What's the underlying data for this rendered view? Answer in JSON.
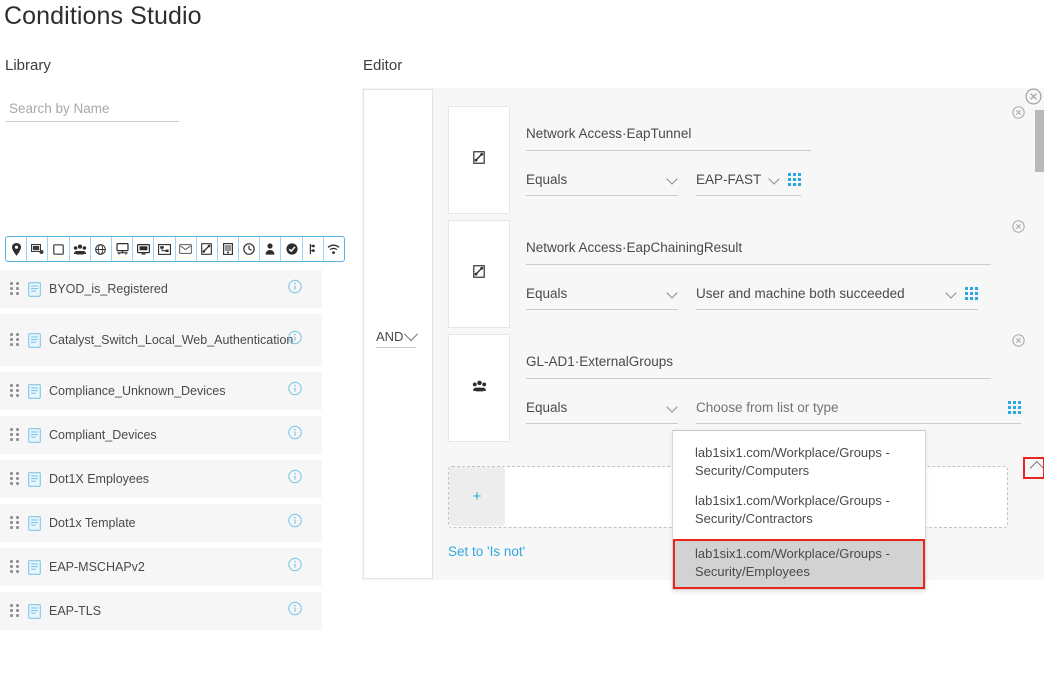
{
  "page": {
    "title": "Conditions Studio"
  },
  "library": {
    "label": "Library",
    "search": {
      "placeholder": "Search by Name",
      "value": ""
    },
    "filter_icons": [
      "location-pin-icon",
      "network-device-icon",
      "square-icon",
      "group-users-icon",
      "globe-icon",
      "desktop-network-icon",
      "monitor-icon",
      "flowchart-icon",
      "mail-icon",
      "network-access-icon",
      "server-icon",
      "clock-icon",
      "user-icon",
      "check-circle-icon",
      "device-sensor-icon",
      "wifi-icon"
    ],
    "items": [
      {
        "label": "BYOD_is_Registered",
        "two_line": false
      },
      {
        "label": "Catalyst_Switch_Local_Web_Authentication",
        "two_line": true
      },
      {
        "label": "Compliance_Unknown_Devices",
        "two_line": false
      },
      {
        "label": "Compliant_Devices",
        "two_line": false
      },
      {
        "label": "Dot1X Employees",
        "two_line": false
      },
      {
        "label": "Dot1x Template",
        "two_line": false
      },
      {
        "label": "EAP-MSCHAPv2",
        "two_line": false
      },
      {
        "label": "EAP-TLS",
        "two_line": false
      }
    ]
  },
  "editor": {
    "label": "Editor",
    "logic_operator": "AND",
    "conditions": [
      {
        "icon": "network-access-icon",
        "attribute": "Network Access·EapTunnel",
        "operator": "Equals",
        "value": "EAP-FAST",
        "is_placeholder": false
      },
      {
        "icon": "network-access-icon",
        "attribute": "Network Access·EapChainingResult",
        "operator": "Equals",
        "value": "User and machine both succeeded",
        "is_placeholder": false
      },
      {
        "icon": "group-users-icon",
        "attribute": "GL-AD1·ExternalGroups",
        "operator": "Equals",
        "value": "Choose from list or type",
        "is_placeholder": true
      }
    ],
    "add_button_label": "+",
    "is_not_link": "Set to 'Is not'",
    "dropdown": {
      "options": [
        {
          "label": "lab1six1.com/Workplace/Groups - Security/Computers",
          "selected": false
        },
        {
          "label": "lab1six1.com/Workplace/Groups - Security/Contractors",
          "selected": false
        },
        {
          "label": "lab1six1.com/Workplace/Groups - Security/Employees",
          "selected": true
        }
      ]
    }
  },
  "colors": {
    "accent_blue": "#2aa9e0",
    "link_blue": "#31a8e0",
    "highlight_red": "#e8251f",
    "panel_bg": "#f7f7f7",
    "list_item_bg": "#f6f6f6"
  }
}
